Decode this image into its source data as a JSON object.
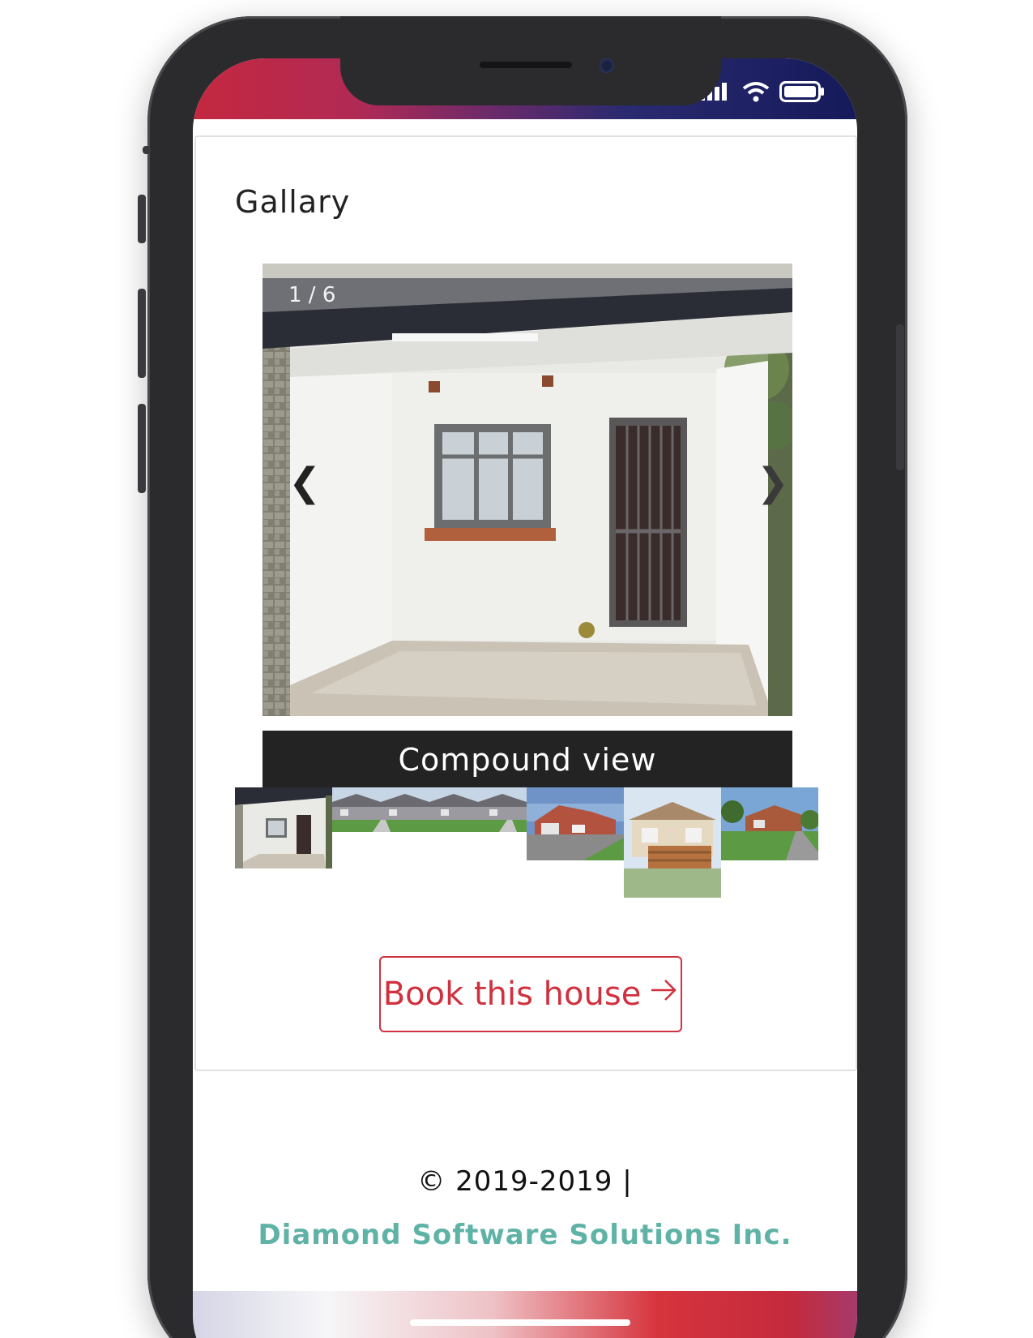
{
  "status_bar": {
    "signal_icon": "signal-bars-icon",
    "wifi_icon": "wifi-icon",
    "battery_icon": "battery-icon"
  },
  "gallery": {
    "title": "Gallary",
    "counter": "1 / 6",
    "prev_label": "❮",
    "next_label": "❯",
    "caption": "Compound view",
    "current_index": 1,
    "total": 6,
    "thumbnails": [
      {
        "name": "thumb-compound"
      },
      {
        "name": "thumb-row-houses-1"
      },
      {
        "name": "thumb-row-houses-2"
      },
      {
        "name": "thumb-brick-house"
      },
      {
        "name": "thumb-deck-house"
      },
      {
        "name": "thumb-lawn-house"
      }
    ]
  },
  "actions": {
    "book_label": "Book this house",
    "book_icon": "arrow-right-icon"
  },
  "footer": {
    "copyright": "© 2019-2019 |",
    "company": "Diamond Software Solutions Inc."
  },
  "colors": {
    "accent": "#d1303e",
    "company": "#5fb3a6",
    "caption_bg": "#232323"
  }
}
